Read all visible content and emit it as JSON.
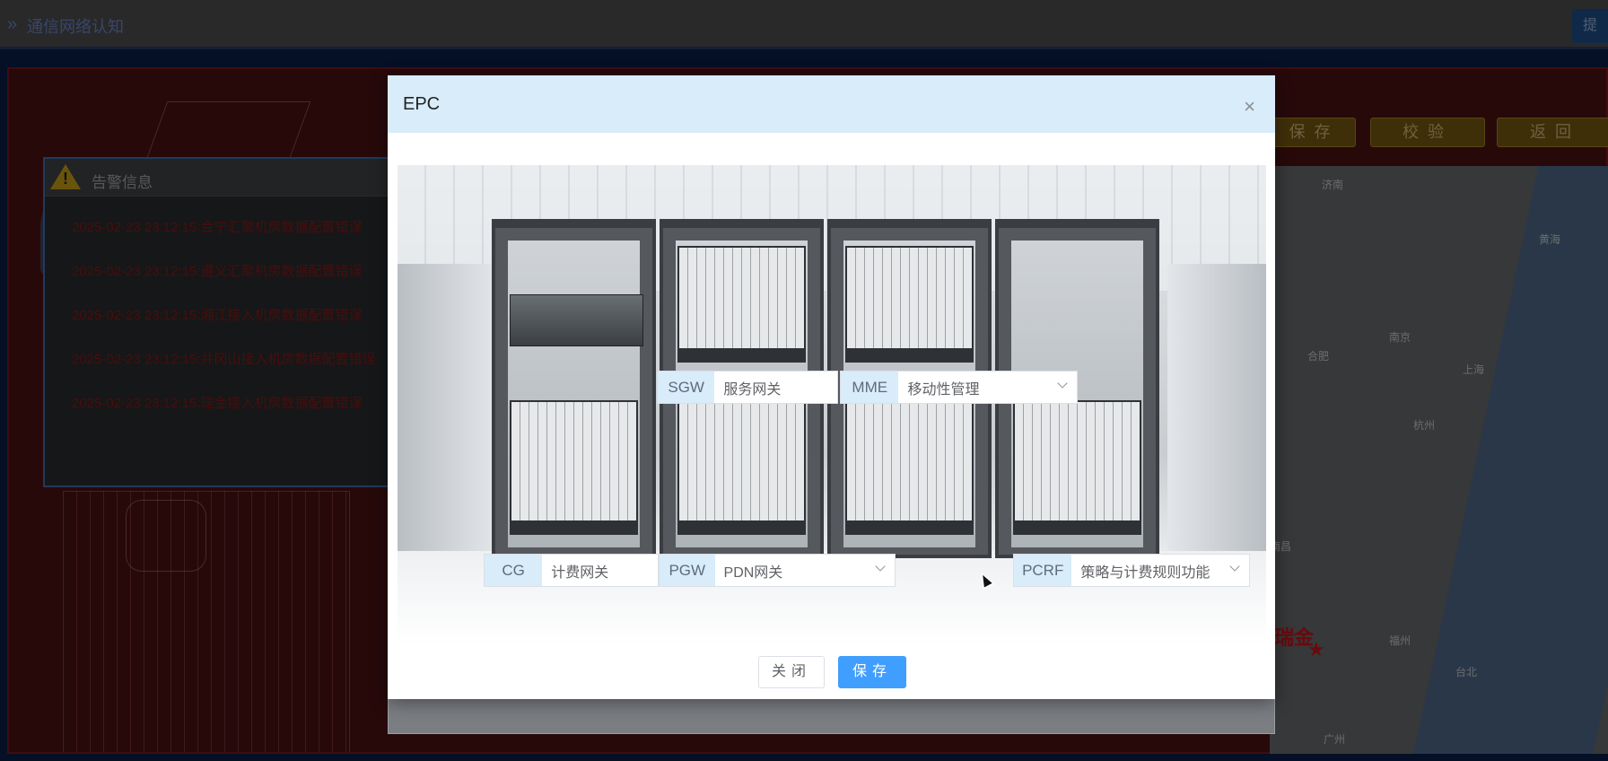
{
  "app": {
    "title": "通信网络认知",
    "submit_label": "提"
  },
  "toolbar": {
    "save_label": "保存",
    "verify_label": "校验",
    "back_label": "返回"
  },
  "alarm_panel": {
    "title": "告警信息",
    "items": [
      "2025-02-23 23:12:15:会宁汇聚机房数据配置错误",
      "2025-02-23 23:12:15:遵义汇聚机房数据配置错误",
      "2025-02-23 23:12:15:湘江接入机房数据配置错误",
      "2025-02-23 23:12:15:井冈山接入机房数据配置错误",
      "2025-02-23 23:12:15:瑞金接入机房数据配置错误"
    ]
  },
  "map": {
    "cities": [
      "济南",
      "黄海",
      "南京",
      "合肥",
      "上海",
      "杭州",
      "南昌",
      "福州",
      "台北",
      "广州"
    ],
    "highlight": "瑞金"
  },
  "modal": {
    "title": "EPC",
    "close_icon": "×",
    "fields": {
      "sgw": {
        "label": "SGW",
        "value": "服务网关"
      },
      "mme": {
        "label": "MME",
        "value": "移动性管理"
      },
      "cg": {
        "label": "CG",
        "value": "计费网关"
      },
      "pgw": {
        "label": "PGW",
        "value": "PDN网关"
      },
      "pcrf": {
        "label": "PCRF",
        "value": "策略与计费规则功能"
      }
    },
    "close_label": "关闭",
    "save_label": "保存"
  },
  "colors": {
    "primary": "#409eff",
    "header_bg": "#d8ecfa",
    "alarm_text": "#8e1a1a"
  }
}
